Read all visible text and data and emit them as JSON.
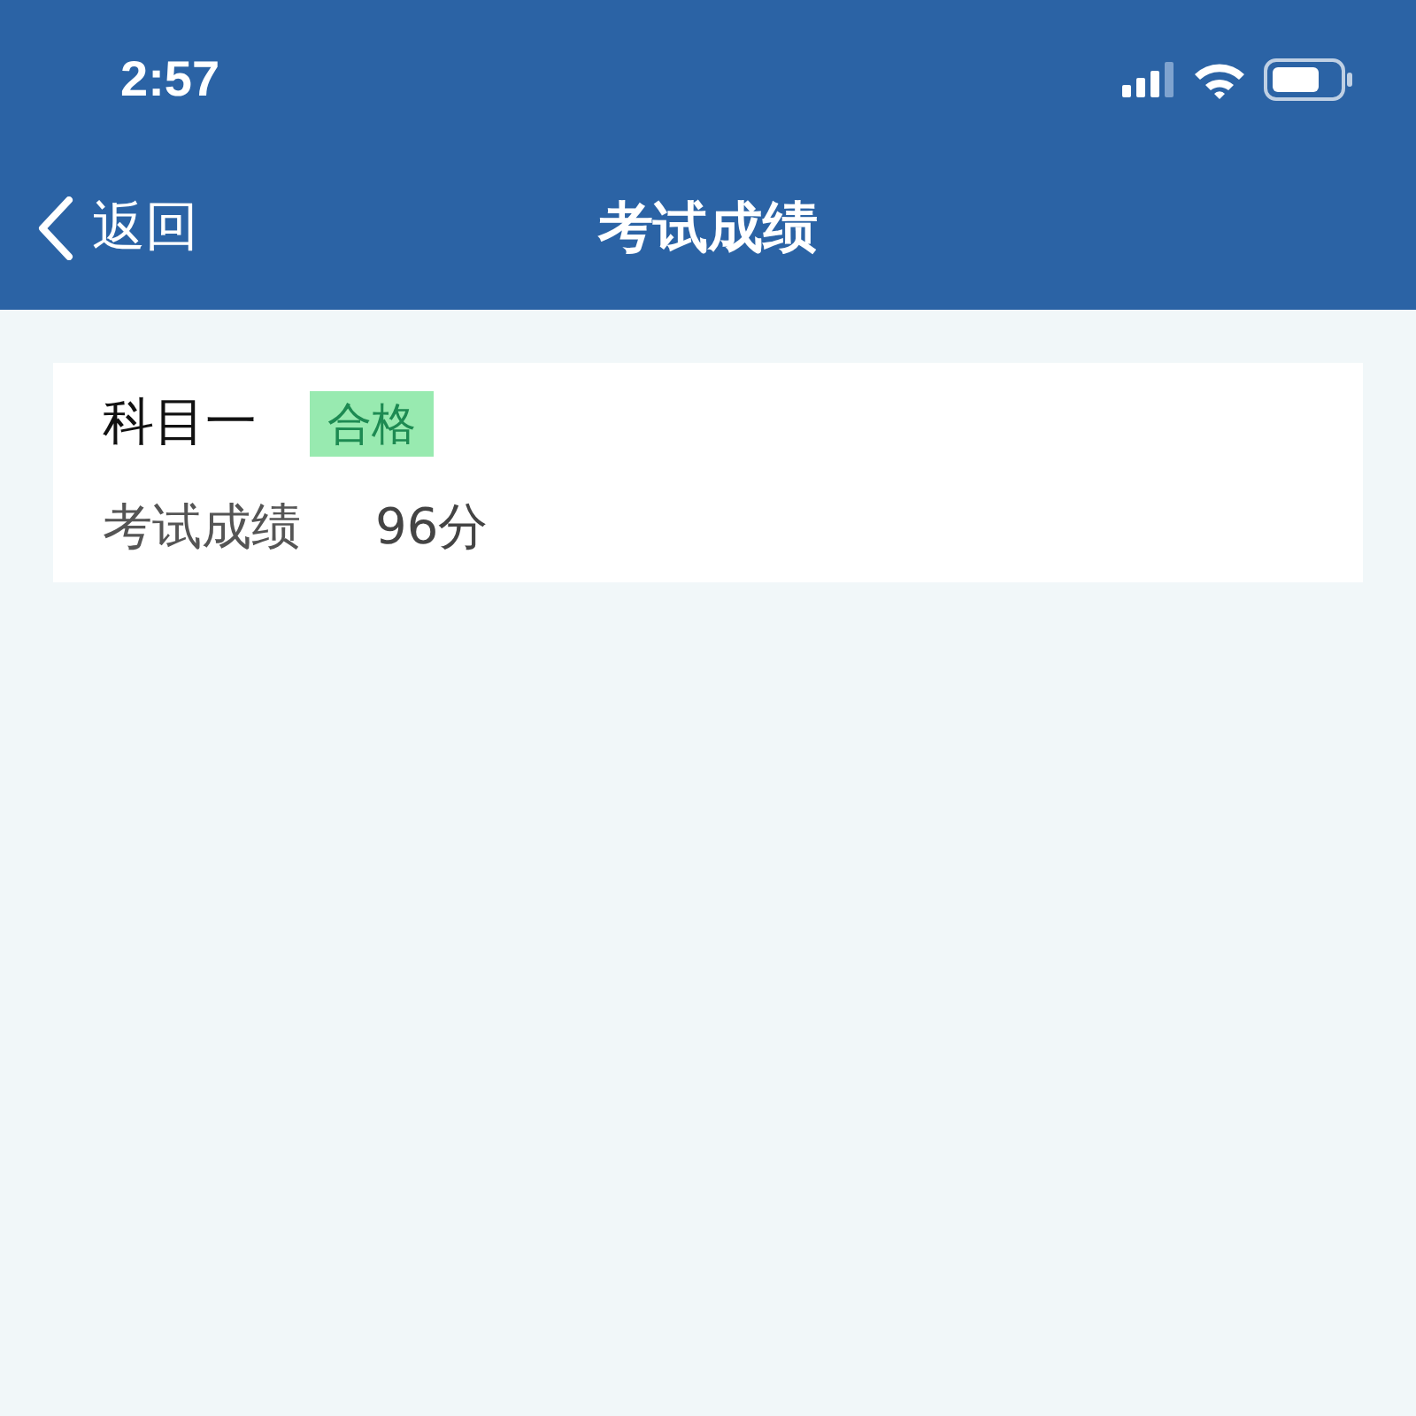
{
  "status_bar": {
    "time": "2:57"
  },
  "nav_bar": {
    "back_label": "返回",
    "title": "考试成绩"
  },
  "results": [
    {
      "subject": "科目一",
      "badge": "合格",
      "score_label": "考试成绩",
      "score": "96分"
    }
  ]
}
